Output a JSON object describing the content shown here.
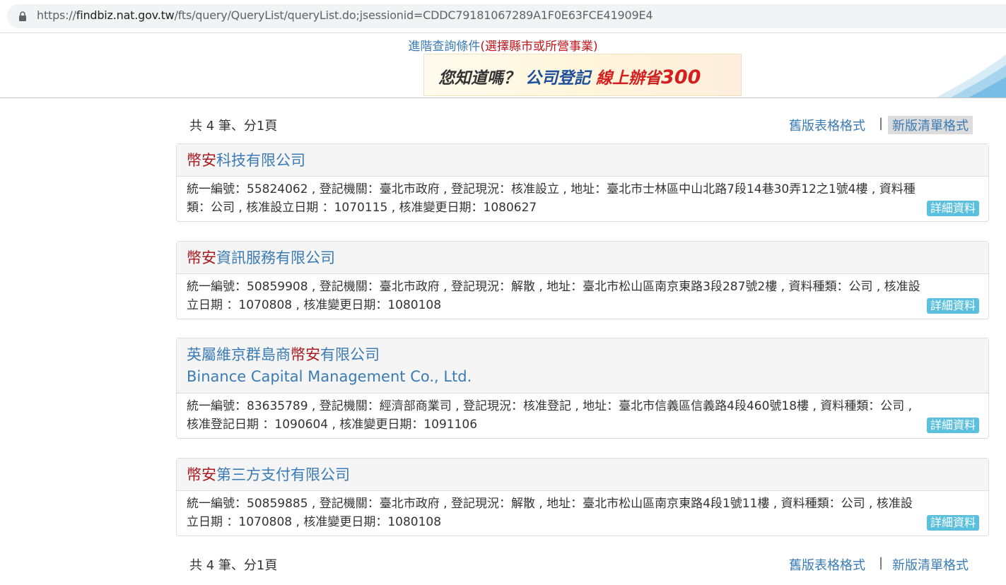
{
  "browser": {
    "url_prefix": "https://",
    "url_host": "findbiz.nat.gov.tw",
    "url_path": "/fts/query/QueryList/queryList.do;jsessionid=CDDC79181067289A1F0E63FCE41909E4"
  },
  "header": {
    "advanced_link": "進階查詢條件",
    "advanced_note": "(選擇縣市或所營事業)",
    "banner": {
      "question": "您知道嗎？",
      "registration": "公司登記",
      "save": "線上辦省",
      "amount": "300"
    }
  },
  "summary_top": "共 4 筆、分1頁",
  "summary_bottom": "共 4 筆、分1頁",
  "formats": {
    "old": "舊版表格格式",
    "separator": "|",
    "new": "新版清單格式"
  },
  "results": [
    {
      "name_prefix": "",
      "name_highlight": "幣安",
      "name_suffix": "科技有限公司",
      "name_en": "",
      "info_line1": "統一編號：55824062 , 登記機關：臺北市政府 , 登記現況：核准設立 , 地址：臺北市士林區中山北路7段14巷30弄12之1號4樓 , 資料種",
      "info_line2": "類：公司 ,  核准設立日期 ：1070115 , 核准變更日期：1080627",
      "detail_label": "詳細資料"
    },
    {
      "name_prefix": "",
      "name_highlight": "幣安",
      "name_suffix": "資訊服務有限公司",
      "name_en": "",
      "info_line1": "統一編號：50859908 , 登記機關：臺北市政府 , 登記現況：解散 , 地址：臺北市松山區南京東路3段287號2樓 , 資料種類：公司 ,  核准設",
      "info_line2": "立日期 ：1070808 , 核准變更日期：1080108",
      "detail_label": "詳細資料"
    },
    {
      "name_prefix": "英屬維京群島商",
      "name_highlight": "幣安",
      "name_suffix": "有限公司",
      "name_en": "Binance Capital Management Co., Ltd.",
      "info_line1": "統一編號：83635789 , 登記機關：經濟部商業司 , 登記現況：核准登記 , 地址：臺北市信義區信義路4段460號18樓 , 資料種類：公司 ,",
      "info_line2": "核准登記日期 ：1090604 , 核准變更日期：1091106",
      "detail_label": "詳細資料"
    },
    {
      "name_prefix": "",
      "name_highlight": "幣安",
      "name_suffix": "第三方支付有限公司",
      "name_en": "",
      "info_line1": "統一編號：50859885 , 登記機關：臺北市政府 , 登記現況：解散 , 地址：臺北市松山區南京東路4段1號11樓 , 資料種類：公司 ,  核准設",
      "info_line2": "立日期 ：1070808 , 核准變更日期：1080108",
      "detail_label": "詳細資料"
    }
  ],
  "colors": {
    "link": "#3b7bb5",
    "highlight": "#a8191f",
    "detail_button": "#5bc0de"
  }
}
